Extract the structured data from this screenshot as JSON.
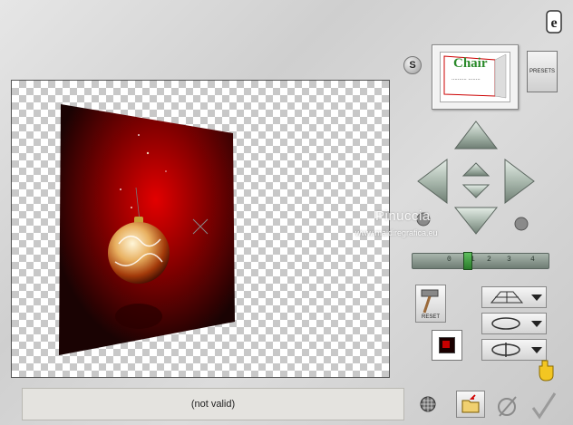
{
  "status": {
    "text": "(not valid)"
  },
  "top": {
    "s_button": "S",
    "presets_label": "PRESETS"
  },
  "thumbnail": {
    "title": "Chair",
    "subtitle": "..........  ........"
  },
  "slider": {
    "marks": [
      "0",
      "1",
      "2",
      "3",
      "4"
    ]
  },
  "reset": {
    "label": "RESET"
  },
  "watermark": {
    "name": "Pinuccia",
    "site": "www.maidiregrafica.eu"
  },
  "colors": {
    "background": "#d6d6d6",
    "arrow": "#c4d1c8",
    "canvas_red": "#c70000",
    "status_bg": "#e4e3df"
  }
}
